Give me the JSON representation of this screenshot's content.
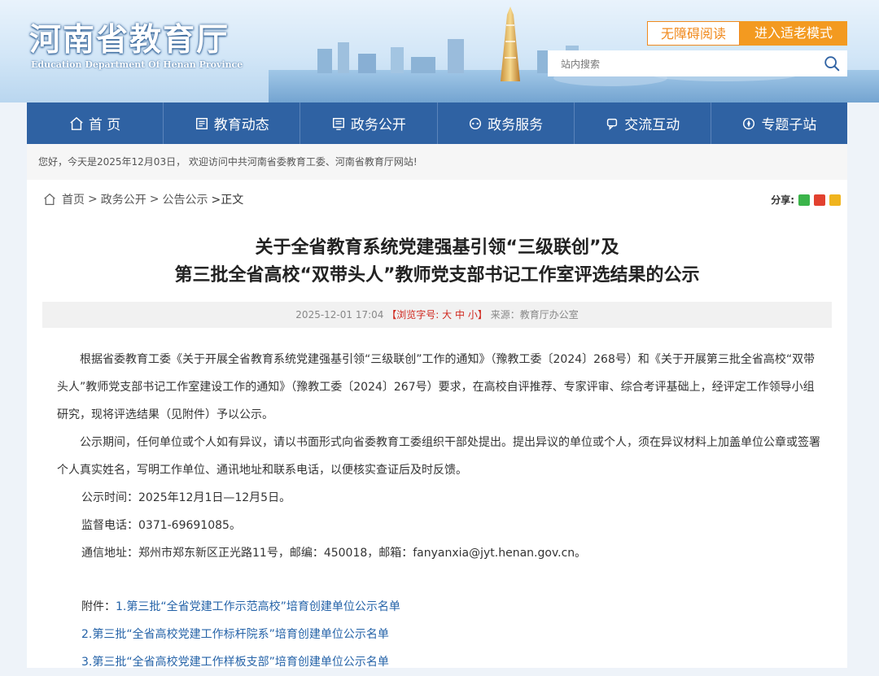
{
  "header": {
    "logo_cn": "河南省教育厅",
    "logo_en": "Education Department Of Henan Province",
    "accessibility_button": "无障碍阅读",
    "elderly_button": "进入适老模式",
    "search_placeholder": "站内搜索"
  },
  "nav": {
    "items": [
      "首 页",
      "教育动态",
      "政务公开",
      "政务服务",
      "交流互动",
      "专题子站"
    ]
  },
  "welcome": "您好，今天是2025年12月03日， 欢迎访问中共河南省委教育工委、河南省教育厅网站!",
  "breadcrumb": {
    "home": "首页",
    "sep": ">",
    "level1": "政务公开",
    "level2": "公告公示",
    "current": ">正文"
  },
  "share": {
    "label": "分享:"
  },
  "article": {
    "title_line1": "关于全省教育系统党建强基引领“三级联创”及",
    "title_line2": "第三批全省高校“双带头人”教师党支部书记工作室评选结果的公示",
    "date": "2025-12-01 17:04",
    "font_label_open": "【浏览字号:",
    "font_big": "大",
    "font_mid": "中",
    "font_small": "小",
    "font_label_close": "】",
    "source": "来源：教育厅办公室",
    "para1": "根据省委教育工委《关于开展全省教育系统党建强基引领“三级联创”工作的通知》（豫教工委〔2024〕268号）和《关于开展第三批全省高校“双带头人”教师党支部书记工作室建设工作的通知》（豫教工委〔2024〕267号）要求，在高校自评推荐、专家评审、综合考评基础上，经评定工作领导小组研究，现将评选结果（见附件）予以公示。",
    "para2": "公示期间，任何单位或个人如有异议，请以书面形式向省委教育工委组织干部处提出。提出异议的单位或个人，须在异议材料上加盖单位公章或签署个人真实姓名，写明工作单位、通讯地址和联系电话，以便核实查证后及时反馈。",
    "para3": "公示时间：2025年12月1日—12月5日。",
    "para4": "监督电话：0371-69691085。",
    "para5": "通信地址：郑州市郑东新区正光路11号，邮编：450018，邮箱：fanyanxia@jyt.henan.gov.cn。",
    "attach_label": "附件：",
    "attachments": [
      "1.第三批“全省党建工作示范高校”培育创建单位公示名单",
      "2.第三批“全省高校党建工作标杆院系”培育创建单位公示名单",
      "3.第三批“全省高校党建工作样板支部”培育创建单位公示名单"
    ]
  },
  "colors": {
    "nav_bg": "#2f62a3",
    "accent_orange": "#f39a20",
    "link_blue": "#2563a8",
    "highlight_red": "#d0281e"
  }
}
